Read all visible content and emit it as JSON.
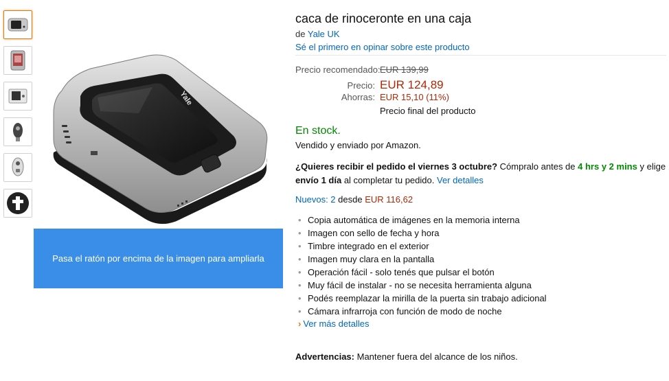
{
  "product": {
    "title": "caca de rinoceronte en una caja",
    "by_prefix": "de",
    "brand": "Yale UK",
    "review_link": "Sé el primero en opinar sobre este producto"
  },
  "pricing": {
    "list_label": "Precio recomendado:",
    "list_price": "EUR 139,99",
    "price_label": "Precio:",
    "price": "EUR 124,89",
    "savings_label": "Ahorras:",
    "savings": "EUR 15,10 (11%)",
    "final_note": "Precio final del producto"
  },
  "availability": {
    "stock": "En stock.",
    "sold_by": "Vendido y enviado por Amazon."
  },
  "delivery": {
    "question": "¿Quieres recibir el pedido el viernes 3 octubre?",
    "order_before": "Cómpralo antes de",
    "countdown": "4 hrs y 2 mins",
    "and_choose": "y elige",
    "option": "envío 1 día",
    "at_checkout": "al completar tu pedido.",
    "details_link": "Ver detalles"
  },
  "offers": {
    "new_link": "Nuevos: 2",
    "from_label": "desde",
    "from_price": "EUR 116,62"
  },
  "features": [
    "Copia automática de imágenes en la memoria interna",
    "Imagen con sello de fecha y hora",
    "Timbre integrado en el exterior",
    "Imagen muy clara en la pantalla",
    "Operación fácil - solo tenés que pulsar el botón",
    "Muy fácil de instalar - no se necesita herramienta alguna",
    "Podés reemplazar la mirilla de la puerta sin trabajo adicional",
    "Cámara infrarroja con función de modo de noche"
  ],
  "more_details": "Ver más detalles",
  "warning": {
    "label": "Advertencias:",
    "text": "Mantener fuera del alcance de los niños."
  },
  "image": {
    "zoom_hint": "Pasa el ratón por encima de la imagen para ampliarla",
    "device_logo": "Yale"
  },
  "colors": {
    "price_red": "#b12704",
    "stock_green": "#008a00",
    "link_blue": "#0066c0",
    "zoom_banner": "#3a8ee8"
  }
}
